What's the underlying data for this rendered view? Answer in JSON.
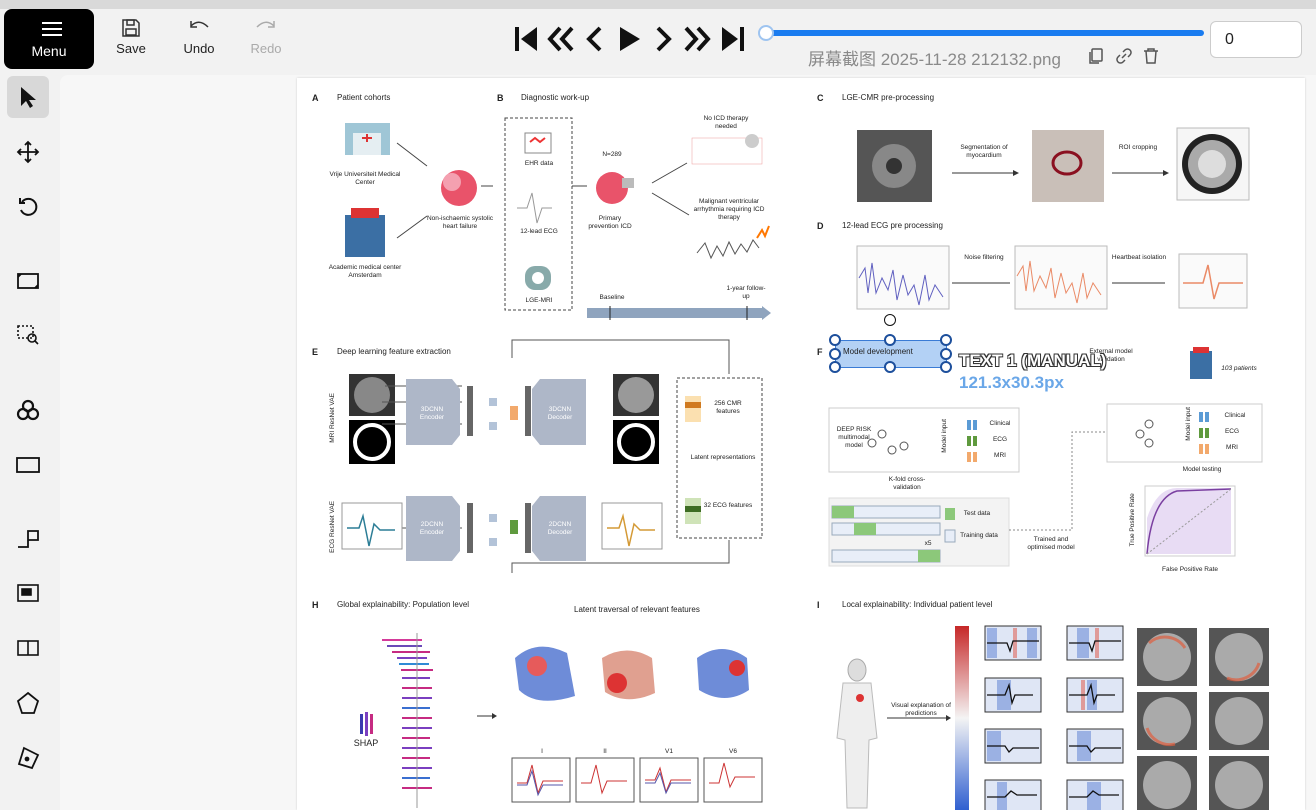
{
  "toolbar": {
    "menu_label": "Menu",
    "save_label": "Save",
    "undo_label": "Undo",
    "redo_label": "Redo"
  },
  "player": {
    "filename": "屏幕截图 2025-11-28 212132.png",
    "frame_value": "0",
    "progress": 0
  },
  "colors": {
    "accent": "#1a7cf0",
    "selection": "#b3d1f5",
    "handle": "#1d4f9c"
  },
  "annotation": {
    "label": "TEXT 1 (MANUAL)",
    "size": "121.3x30.3px",
    "box_text": "Model development"
  },
  "figure": {
    "A": {
      "letter": "A",
      "title": "Patient cohorts",
      "c1": "Vrije Universiteit Medical Center",
      "c2": "Academic medical center Amsterdam",
      "heart": "Non-ischaemic systolic heart failure"
    },
    "B": {
      "letter": "B",
      "title": "Diagnostic work-up",
      "ehr": "EHR data",
      "ecg": "12-lead ECG",
      "mri": "LGE-MRI",
      "n": "N=289",
      "icd": "Primary prevention ICD",
      "no_icd": "No ICD therapy needed",
      "mal": "Malignant ventricular arrhythmia requiring ICD therapy",
      "baseline": "Baseline",
      "followup": "1-year follow-up"
    },
    "C": {
      "letter": "C",
      "title": "LGE-CMR pre-processing",
      "seg": "Segmentation of myocardium",
      "roi": "ROI cropping"
    },
    "D": {
      "letter": "D",
      "title": "12-lead ECG pre processing",
      "noise": "Noise filtering",
      "hb": "Heartbeat isolation"
    },
    "E": {
      "letter": "E",
      "title": "Deep learning feature extraction",
      "mri_vae": "MRI ResNet VAE",
      "ecg_vae": "ECG ResNet VAE",
      "enc3": "3DCNN Encoder",
      "dec3": "3DCNN Decoder",
      "enc2": "2DCNN Encoder",
      "dec2": "2DCNN Decoder",
      "cmr_feat": "256 CMR features",
      "latent": "Latent representations",
      "ecg_feat": "32 ECG features"
    },
    "F": {
      "letter": "F",
      "ext": "External model validation",
      "patients": "103 patients",
      "deep": "DEEP RISK multimodal model",
      "clinical": "Clinical",
      "ecg": "ECG",
      "mri": "MRI",
      "model_input": "Model input",
      "kfold": "K-fold cross-validation",
      "test": "Test data",
      "train": "Training data",
      "x5": "x5",
      "trained": "Trained and optimised model",
      "testing": "Model testing",
      "tpr": "True Positive Rate",
      "fpr": "False Positive Rate"
    },
    "H": {
      "letter": "H",
      "title": "Global explainability: Population level",
      "latent": "Latent traversal of relevant features",
      "shap": "SHAP",
      "leads": [
        "I",
        "II",
        "V1",
        "V6"
      ]
    },
    "I": {
      "letter": "I",
      "title": "Local explainability: Individual patient level",
      "visual": "Visual explanation of predictions"
    }
  }
}
